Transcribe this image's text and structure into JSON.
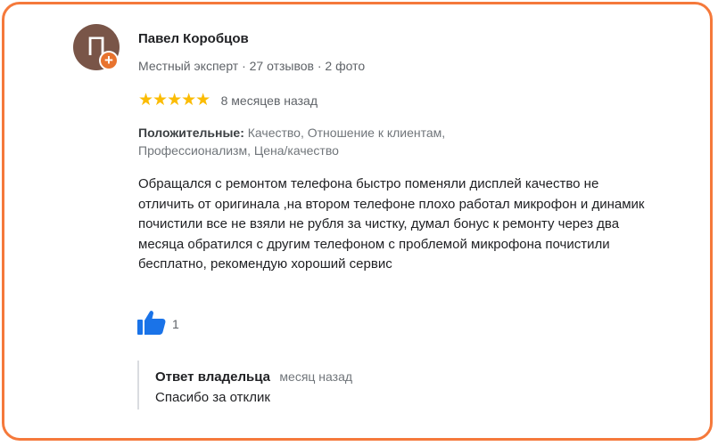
{
  "reviewer": {
    "avatar_letter": "П",
    "avatar_color": "#795548",
    "badge_symbol": "+",
    "badge_color": "#e8732e",
    "name": "Павел Коробцов",
    "meta": "Местный эксперт · 27 отзывов · 2 фото"
  },
  "review": {
    "stars": "★★★★★",
    "star_color": "#fbbc04",
    "rating": 5,
    "date": "8 месяцев назад",
    "positive_label": "Положительные:",
    "positive_values": " Качество, Отношение к клиентам, Профессионализм, Цена/качество",
    "text": "Обращался с ремонтом телефона быстро поменяли дисплей качество не отличить от оригинала ,на втором телефоне плохо работал микрофон и динамик почистили все не взяли не рубля за чистку, думал бонус к ремонту через два месяца обратился с другим телефоном с проблемой микрофона почистили бесплатно, рекомендую хороший сервис",
    "likes": "1",
    "like_icon": "thumbs-up-icon",
    "like_color": "#1a73e8"
  },
  "owner_response": {
    "label": "Ответ владельца",
    "date": "месяц назад",
    "text": "Спасибо за отклик"
  },
  "frame_color": "#f5793b"
}
